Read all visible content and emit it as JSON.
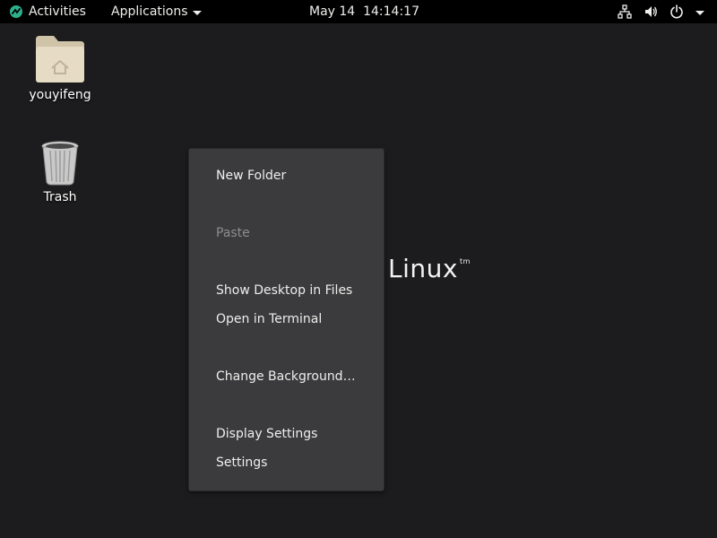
{
  "topbar": {
    "activities_label": "Activities",
    "applications_label": "Applications",
    "clock": "May 14  14:14:17",
    "icons": [
      "network-icon",
      "volume-icon",
      "power-icon",
      "chevron-down-icon"
    ]
  },
  "desktop": {
    "icons": [
      {
        "label": "youyifeng",
        "icon": "home-folder-icon"
      },
      {
        "label": "Trash",
        "icon": "trash-icon"
      }
    ],
    "watermark": {
      "text": "Linux",
      "tm": "tm"
    }
  },
  "context_menu": {
    "items": [
      {
        "label": "New Folder",
        "enabled": true
      },
      {
        "label": "Paste",
        "enabled": false
      },
      {
        "label": "Show Desktop in Files",
        "enabled": true
      },
      {
        "label": "Open in Terminal",
        "enabled": true
      },
      {
        "label": "Change Background…",
        "enabled": true
      },
      {
        "label": "Display Settings",
        "enabled": true
      },
      {
        "label": "Settings",
        "enabled": true
      }
    ]
  },
  "colors": {
    "desktop_bg": "#1c1c1e",
    "topbar_bg": "#000000",
    "menu_bg": "#3b3b3e",
    "logo_green": "#2eb08c"
  }
}
